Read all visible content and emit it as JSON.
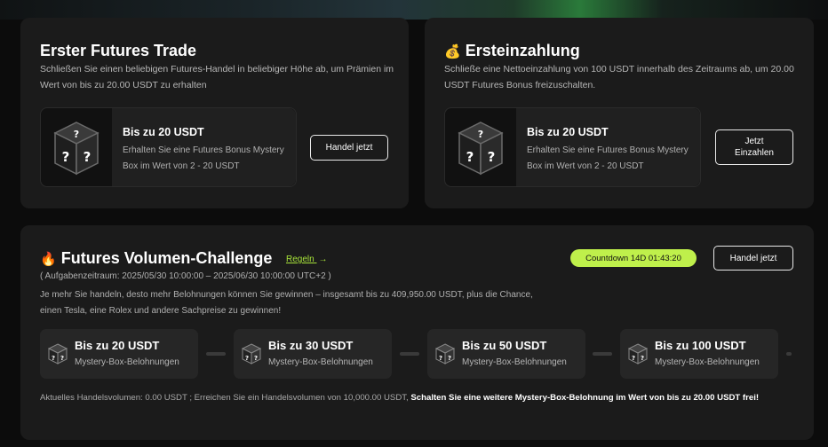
{
  "cards": {
    "first_trade": {
      "title": "Erster Futures Trade",
      "desc": "Schließen Sie einen beliebigen Futures-Handel in beliebiger Höhe ab, um Prämien im Wert von bis zu 20.00 USDT zu erhalten",
      "reward_title": "Bis zu 20 USDT",
      "reward_sub": "Erhalten Sie eine Futures Bonus Mystery Box im Wert von 2 - 20 USDT",
      "button": "Handel jetzt"
    },
    "first_deposit": {
      "icon": "money-bag-icon",
      "title": "Ersteinzahlung",
      "desc": "Schließe eine Nettoeinzahlung von 100 USDT innerhalb des Zeitraums ab, um 20.00 USDT Futures Bonus freizuschalten.",
      "reward_title": "Bis zu 20 USDT",
      "reward_sub": "Erhalten Sie eine Futures Bonus Mystery Box im Wert von 2 - 20 USDT",
      "button": "Jetzt Einzahlen"
    }
  },
  "challenge": {
    "icon": "fire-icon",
    "title": "Futures Volumen-Challenge",
    "rules_link": "Regeln",
    "period": "( Aufgabenzeitraum: 2025/05/30 10:00:00 – 2025/06/30 10:00:00 UTC+2 )",
    "desc": "Je mehr Sie handeln, desto mehr Belohnungen können Sie gewinnen – insgesamt bis zu 409,950.00 USDT, plus die Chance, einen Tesla, eine Rolex und andere Sachpreise zu gewinnen!",
    "countdown": "Countdown 14D 01:43:20",
    "button": "Handel jetzt",
    "tiers": [
      {
        "title": "Bis zu 20 USDT",
        "sub": "Mystery-Box-Belohnungen"
      },
      {
        "title": "Bis zu 30 USDT",
        "sub": "Mystery-Box-Belohnungen"
      },
      {
        "title": "Bis zu 50 USDT",
        "sub": "Mystery-Box-Belohnungen"
      },
      {
        "title": "Bis zu 100 USDT",
        "sub": "Mystery-Box-Belohnungen"
      }
    ],
    "footer_plain": "Aktuelles Handelsvolumen: 0.00 USDT ; Erreichen Sie ein Handelsvolumen von 10,000.00 USDT,",
    "footer_highlight": "Schalten Sie eine weitere Mystery-Box-Belohnung im Wert von bis zu 20.00 USDT frei!"
  },
  "colors": {
    "accent": "#bff04b",
    "card_bg": "#1b1b1b",
    "page_bg": "#0c0c0c"
  }
}
